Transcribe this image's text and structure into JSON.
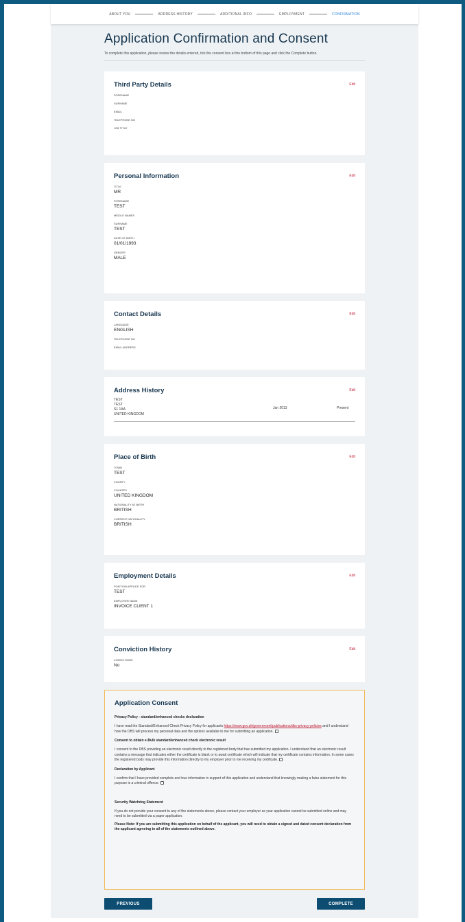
{
  "stepper": {
    "steps": [
      {
        "label": "ABOUT YOU",
        "active": false
      },
      {
        "label": "ADDRESS HISTORY",
        "active": false
      },
      {
        "label": "ADDITIONAL INFO",
        "active": false
      },
      {
        "label": "EMPLOYMENT",
        "active": false
      },
      {
        "label": "CONFIRMATION",
        "active": true
      }
    ]
  },
  "header": {
    "title": "Application Confirmation and Consent",
    "subtitle": "To complete this application, please review the details entered, tick the consent box at the bottom of this page and click the Complete button."
  },
  "edit_label": "Edit",
  "third_party": {
    "title": "Third Party Details",
    "fields": [
      {
        "label": "FORENAME",
        "value": ""
      },
      {
        "label": "SURNAME",
        "value": ""
      },
      {
        "label": "EMAIL",
        "value": ""
      },
      {
        "label": "TELEPHONE NO",
        "value": ""
      },
      {
        "label": "JOB TITLE",
        "value": ""
      }
    ]
  },
  "personal": {
    "title": "Personal Information",
    "fields": [
      {
        "label": "TITLE",
        "value": "MR"
      },
      {
        "label": "FORENAME",
        "value": "TEST"
      },
      {
        "label": "MIDDLE NAMES",
        "value": ""
      },
      {
        "label": "SURNAME",
        "value": "TEST"
      },
      {
        "label": "DATE OF BIRTH",
        "value": "01/01/1993"
      },
      {
        "label": "GENDER",
        "value": "MALE"
      }
    ]
  },
  "contact": {
    "title": "Contact Details",
    "fields": [
      {
        "label": "LANGUAGE",
        "value": "ENGLISH"
      },
      {
        "label": "TELEPHONE NO",
        "value": ""
      },
      {
        "label": "EMAIL ADDRESS",
        "value": ""
      }
    ]
  },
  "address": {
    "title": "Address History",
    "lines": [
      "TEST",
      "TEST",
      "S1 1AA",
      "UNITED KINGDOM"
    ],
    "from": "Jan 2013",
    "to": "Present"
  },
  "birth": {
    "title": "Place of Birth",
    "fields": [
      {
        "label": "TOWN",
        "value": "TEST"
      },
      {
        "label": "COUNTY",
        "value": ""
      },
      {
        "label": "COUNTRY",
        "value": "UNITED KINGDOM"
      },
      {
        "label": "NATIONALITY AT BIRTH",
        "value": "BRITISH"
      },
      {
        "label": "CURRENT NATIONALITY",
        "value": "BRITISH"
      }
    ]
  },
  "employment": {
    "title": "Employment Details",
    "fields": [
      {
        "label": "POSITION APPLIED FOR",
        "value": "TEST"
      },
      {
        "label": "EMPLOYER NAME",
        "value": "INVOICE CLIENT 1"
      }
    ]
  },
  "conviction": {
    "title": "Conviction History",
    "fields": [
      {
        "label": "CONVICTIONS",
        "value": "No"
      }
    ]
  },
  "consent": {
    "title": "Application Consent",
    "privacy_head": "Privacy Policy - standard/enhanced checks declaration",
    "privacy_text_a": "I have read the Standard/Enhanced Check Privacy Policy for applicants ",
    "privacy_link": "https://www.gov.uk/government/publications/dbs-privacy-policies",
    "privacy_text_b": " and I understand how the DBS will process my personal data and the options available to me for submitting an application.",
    "ebulk_head": "Consent to obtain e-Bulk standard/enhanced check electronic result",
    "ebulk_text": "I consent to the DBS providing an electronic result directly to the registered body that has submitted my application. I understand that an electronic result contains a message that indicates either the certificate is blank or to await certificate which will indicate that my certificate contains information. In some cases the registered body may provide this information directly to my employer prior to me receiving my certificate.",
    "decl_head": "Declaration by Applicant",
    "decl_text": "I confirm that I have provided complete and true information in support of this application and understand that knowingly making a false statement for this purpose is a criminal offence.",
    "watchdog_head": "Security Watchdog Statement",
    "watchdog_text": "If you do not provide your consent to any of the statements above, please contact your employer as your application cannot be submitted online and may need to be submitted via a paper application.",
    "note_text": "Please Note: If you are submitting this application on behalf of the applicant, you will need to obtain a signed and dated consent declaration from the applicant agreeing to all of the statements outlined above."
  },
  "buttons": {
    "previous": "PREVIOUS",
    "complete": "COMPLETE"
  }
}
